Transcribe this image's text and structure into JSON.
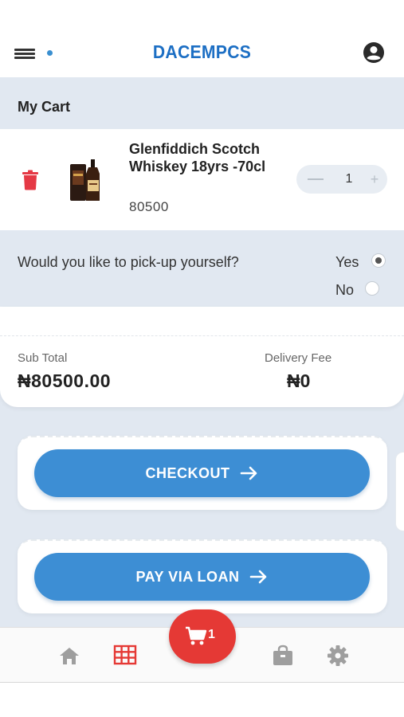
{
  "header": {
    "title": "DACEMPCS",
    "menu_icon": "hamburger-menu-icon",
    "profile_icon": "account-circle-icon"
  },
  "cart": {
    "section_title": "My Cart",
    "item": {
      "name": "Glenfiddich Scotch Whiskey 18yrs -70cl",
      "price": "80500",
      "quantity": "1",
      "minus_icon": "minus-icon",
      "plus_label": "+",
      "delete_icon": "trash-icon"
    }
  },
  "pickup": {
    "question": "Would you like to pick-up yourself?",
    "options": [
      "Yes",
      "No"
    ],
    "selected": "Yes"
  },
  "totals": {
    "subtotal_label": "Sub Total",
    "subtotal_value": "₦80500.00",
    "delivery_label": "Delivery Fee",
    "delivery_value": "₦0"
  },
  "actions": {
    "checkout_label": "CHECKOUT",
    "loan_label": "PAY VIA LOAN"
  },
  "bottom_nav": {
    "cart_count": "1",
    "items": [
      "home-icon",
      "grid-icon",
      "cart-icon",
      "shopping-bag-icon",
      "settings-icon"
    ]
  },
  "colors": {
    "brand": "#1d6fc4",
    "button": "#3d8ed4",
    "danger": "#e53935",
    "background": "#e1e8f1"
  }
}
